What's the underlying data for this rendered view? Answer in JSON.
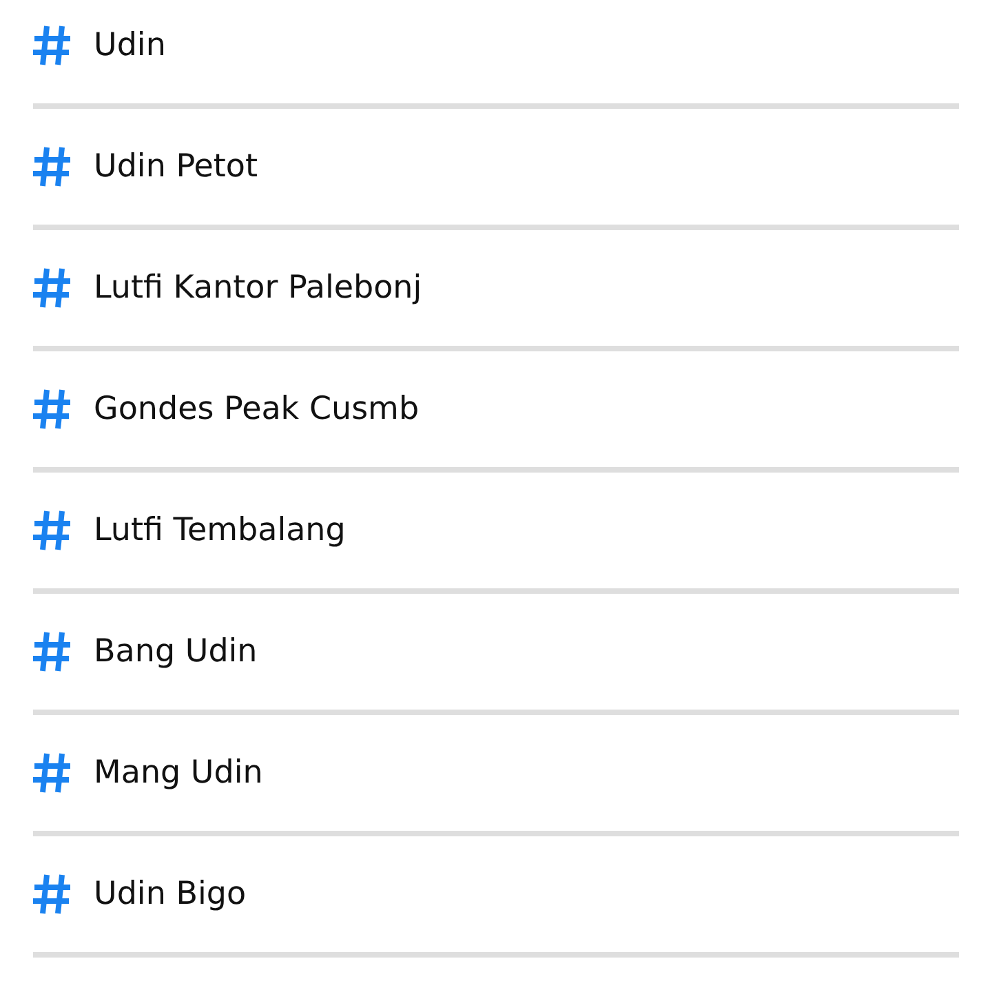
{
  "hashtags": [
    {
      "label": "Udin"
    },
    {
      "label": "Udin Petot"
    },
    {
      "label": "Lutfi Kantor Palebonj"
    },
    {
      "label": "Gondes Peak Cusmb"
    },
    {
      "label": "Lutfi Tembalang"
    },
    {
      "label": "Bang Udin"
    },
    {
      "label": "Mang Udin"
    },
    {
      "label": "Udin Bigo"
    }
  ]
}
